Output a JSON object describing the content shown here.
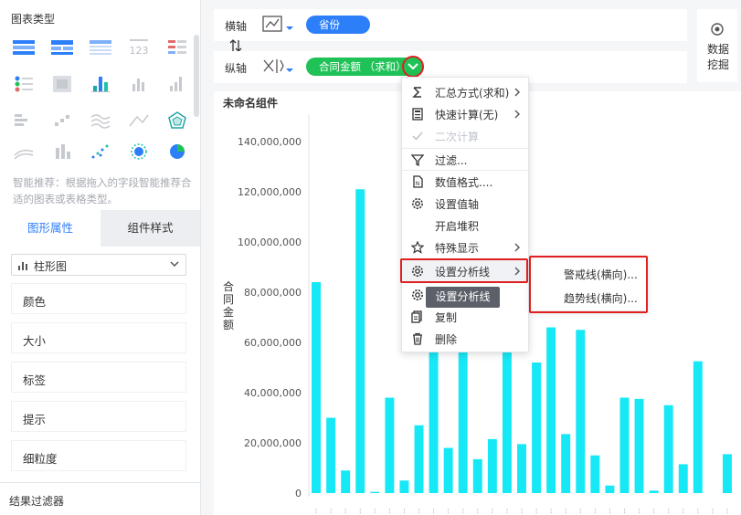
{
  "left_panel": {
    "chart_types_title": "图表类型",
    "smart_tip": "智能推荐：根据拖入的字段智能推荐合适的图表或表格类型。",
    "tabs": [
      {
        "label": "图形属性",
        "active": true
      },
      {
        "label": "组件样式",
        "active": false
      }
    ],
    "chart_type_selected": "柱形图",
    "properties": [
      "颜色",
      "大小",
      "标签",
      "提示",
      "细粒度"
    ],
    "result_filter": "结果过滤器"
  },
  "axis": {
    "x_label": "横轴",
    "x_field": "省份",
    "y_label": "纵轴",
    "y_field": "合同金额 （求和）"
  },
  "data_mining": "数据挖掘",
  "component_title": "未命名组件",
  "context_menu": {
    "items": [
      {
        "label": "汇总方式(求和)",
        "icon": "sigma-icon",
        "submenu": true,
        "disabled": false
      },
      {
        "label": "快速计算(无)",
        "icon": "calculator-icon",
        "submenu": true,
        "disabled": false
      },
      {
        "label": "二次计算",
        "icon": "check-icon",
        "submenu": false,
        "disabled": true
      },
      {
        "label": "过滤...",
        "icon": "filter-icon",
        "submenu": false,
        "disabled": false
      },
      {
        "label": "数值格式....",
        "icon": "number-format-icon",
        "submenu": false,
        "disabled": false
      },
      {
        "label": "设置值轴",
        "icon": "gear-icon",
        "submenu": false,
        "disabled": false
      },
      {
        "label": "开启堆积",
        "icon": "",
        "submenu": false,
        "disabled": false
      },
      {
        "label": "特殊显示",
        "icon": "star-icon",
        "submenu": true,
        "disabled": false
      },
      {
        "label": "设置分析线",
        "icon": "gear-icon",
        "submenu": true,
        "disabled": false
      },
      {
        "label": "复制",
        "icon": "copy-icon",
        "submenu": false,
        "disabled": false
      },
      {
        "label": "删除",
        "icon": "trash-icon",
        "submenu": false,
        "disabled": false
      }
    ],
    "tooltip": "设置分析线"
  },
  "analysis_submenu": [
    "警戒线(横向)...",
    "趋势线(横向)..."
  ],
  "colors": {
    "accent": "#2d7ff9",
    "pill_green": "#1fc256",
    "bar": "#17e8f5",
    "highlight": "#e02020"
  },
  "chart_data": {
    "type": "bar",
    "ylabel": "合同金额",
    "ylim": [
      0,
      140000000
    ],
    "y_ticks": [
      "140,000,000",
      "120,000,000",
      "100,000,000",
      "80,000,000",
      "60,000,000",
      "40,000,000",
      "20,000,000",
      "0"
    ],
    "values": [
      84000000,
      30000000,
      9000000,
      121000000,
      500000,
      38000000,
      5000000,
      27000000,
      56000000,
      18000000,
      56000000,
      13500000,
      21500000,
      56000000,
      19500000,
      52000000,
      66000000,
      23500000,
      65000000,
      15000000,
      3000000,
      38000000,
      37500000,
      1000000,
      35000000,
      11500000,
      52500000,
      0,
      15500000
    ]
  }
}
